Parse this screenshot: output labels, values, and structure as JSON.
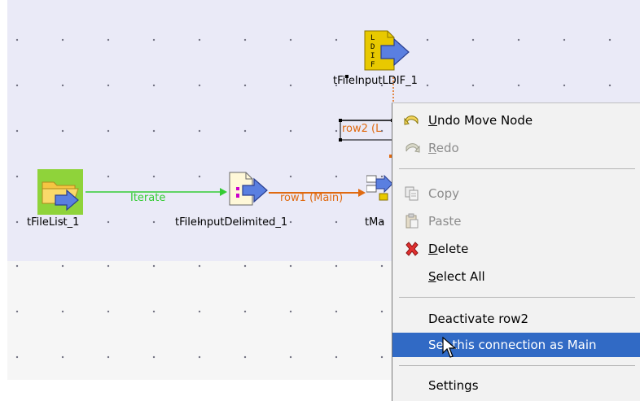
{
  "nodes": {
    "file_list": {
      "label": "tFileList_1",
      "icon": "folder-arrow-icon"
    },
    "file_input_delimited": {
      "label": "tFileInputDelimited_1",
      "icon": "delimited-file-icon"
    },
    "file_input_ldif": {
      "label": "tFileInputLDIF_1",
      "icon": "ldif-file-icon",
      "icon_text": "LDIF"
    },
    "tmap": {
      "label": "tMa",
      "icon": "tmap-icon"
    }
  },
  "connections": {
    "iterate": {
      "label": "Iterate",
      "color": "#33cc33"
    },
    "row1": {
      "label": "row1 (Main)",
      "color": "#e06a10"
    },
    "row2": {
      "label": "row2 (L",
      "color": "#e06a10"
    }
  },
  "context_menu": {
    "items": [
      {
        "id": "undo",
        "label": "Undo Move Node",
        "mnemonic": "U",
        "rest": "ndo Move Node",
        "icon": "undo-icon",
        "enabled": true
      },
      {
        "id": "redo",
        "label": "Redo",
        "mnemonic": "R",
        "rest": "edo",
        "icon": "redo-icon",
        "enabled": false
      },
      {
        "id": "copy",
        "label": "Copy",
        "icon": "copy-icon",
        "enabled": false
      },
      {
        "id": "paste",
        "label": "Paste",
        "icon": "paste-icon",
        "enabled": false
      },
      {
        "id": "delete",
        "label": "Delete",
        "mnemonic": "D",
        "rest": "elete",
        "icon": "delete-icon",
        "enabled": true
      },
      {
        "id": "select_all",
        "label": "Select All",
        "mnemonic": "S",
        "rest": "elect All",
        "enabled": true
      },
      {
        "id": "deactivate",
        "label": "Deactivate row2",
        "enabled": true
      },
      {
        "id": "set_main",
        "label": "Set this connection as Main",
        "enabled": true,
        "highlighted": true
      },
      {
        "id": "settings",
        "label": "Settings",
        "enabled": true
      }
    ]
  },
  "colors": {
    "menu_highlight": "#316ac5",
    "canvas_top": "#eaeaf7",
    "canvas_bottom": "#f6f6f6"
  }
}
